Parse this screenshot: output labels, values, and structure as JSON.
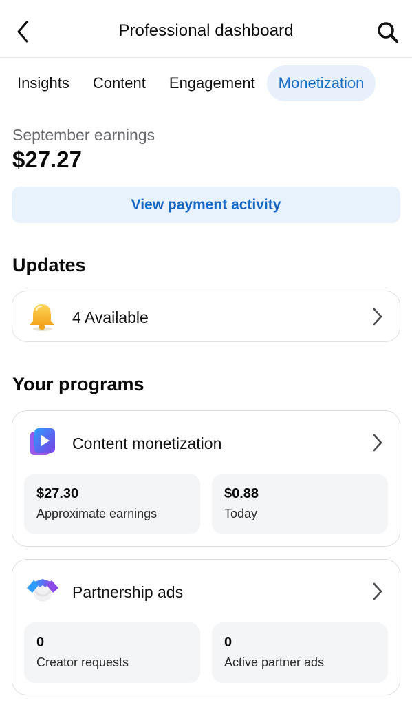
{
  "header": {
    "title": "Professional dashboard"
  },
  "tabs": [
    {
      "label": "Insights",
      "active": false
    },
    {
      "label": "Content",
      "active": false
    },
    {
      "label": "Engagement",
      "active": false
    },
    {
      "label": "Monetization",
      "active": true
    }
  ],
  "earnings": {
    "label": "September earnings",
    "value": "$27.27"
  },
  "payment_button": {
    "label": "View payment activity"
  },
  "updates": {
    "title": "Updates",
    "item_label": "4 Available",
    "icon": "bell-icon"
  },
  "programs": {
    "title": "Your programs",
    "items": [
      {
        "label": "Content monetization",
        "icon": "video-play-icon",
        "stats": [
          {
            "value": "$27.30",
            "label": "Approximate earnings"
          },
          {
            "value": "$0.88",
            "label": "Today"
          }
        ]
      },
      {
        "label": "Partnership ads",
        "icon": "handshake-icon",
        "stats": [
          {
            "value": "0",
            "label": "Creator requests"
          },
          {
            "value": "0",
            "label": "Active partner ads"
          }
        ]
      }
    ]
  },
  "colors": {
    "accent": "#1a6fc4",
    "active_tab_bg": "#e8f1fb",
    "card_border": "#dcdfe3",
    "stat_bg": "#f4f5f7"
  }
}
